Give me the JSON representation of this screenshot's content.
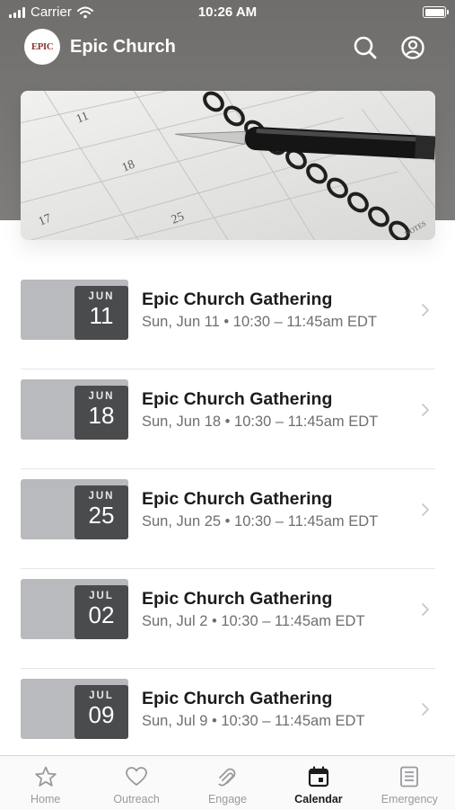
{
  "status_bar": {
    "carrier": "Carrier",
    "time": "10:26 AM"
  },
  "header": {
    "logo_text": "EPIC",
    "title": "Epic Church",
    "icons": [
      "search-icon",
      "profile-icon"
    ]
  },
  "hero": {
    "image": "notebook-with-pen-photo",
    "calendar_numbers": [
      "11",
      "18",
      "17",
      "25"
    ],
    "notes_label": "NOTES"
  },
  "events": [
    {
      "month": "JUN",
      "day": "11",
      "title": "Epic Church Gathering",
      "meta": "Sun, Jun 11 • 10:30 – 11:45am EDT"
    },
    {
      "month": "JUN",
      "day": "18",
      "title": "Epic Church Gathering",
      "meta": "Sun, Jun 18 • 10:30 – 11:45am EDT"
    },
    {
      "month": "JUN",
      "day": "25",
      "title": "Epic Church Gathering",
      "meta": "Sun, Jun 25 • 10:30 – 11:45am EDT"
    },
    {
      "month": "JUL",
      "day": "02",
      "title": "Epic Church Gathering",
      "meta": "Sun, Jul 2 • 10:30 – 11:45am EDT"
    },
    {
      "month": "JUL",
      "day": "09",
      "title": "Epic Church Gathering",
      "meta": "Sun, Jul 9 • 10:30 – 11:45am EDT"
    }
  ],
  "tabs": [
    {
      "label": "Home",
      "icon": "star-icon",
      "active": false
    },
    {
      "label": "Outreach",
      "icon": "heart-icon",
      "active": false
    },
    {
      "label": "Engage",
      "icon": "engage-icon",
      "active": false
    },
    {
      "label": "Calendar",
      "icon": "calendar-icon",
      "active": true
    },
    {
      "label": "Emergency",
      "icon": "document-icon",
      "active": false
    }
  ],
  "colors": {
    "header_band": "#777674",
    "date_badge": "#4a4b4d",
    "thumb": "#b9babd",
    "active_tab": "#1c1c1e",
    "inactive_tab": "#9a9a9e"
  }
}
